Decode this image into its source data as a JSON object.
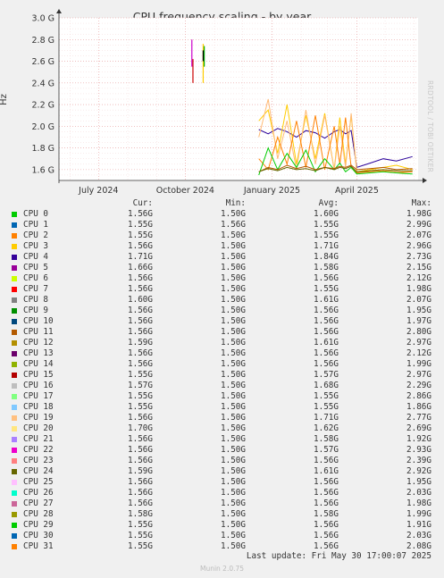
{
  "chart_data": {
    "type": "line",
    "title": "CPU frequency scaling - by year",
    "ylabel": "Hz",
    "ylim": [
      1.5,
      3.0
    ],
    "yticks": [
      "1.6 G",
      "1.8 G",
      "2.0 G",
      "2.2 G",
      "2.4 G",
      "2.6 G",
      "2.8 G",
      "3.0 G"
    ],
    "ytick_values": [
      1.6,
      1.8,
      2.0,
      2.2,
      2.4,
      2.6,
      2.8,
      3.0
    ],
    "xlim": [
      "2024-05-20",
      "2025-06-05"
    ],
    "xticks": [
      "July 2024",
      "October 2024",
      "January 2025",
      "April 2025"
    ],
    "xtick_dates": [
      "2024-07-01",
      "2024-10-01",
      "2025-01-01",
      "2025-04-01"
    ],
    "grid": true,
    "series": [
      {
        "name": "CPU 4",
        "color": "#2a0099",
        "y": [
          1.97,
          1.93,
          1.98,
          1.95,
          1.9,
          1.96,
          1.94,
          1.89,
          1.95,
          1.97,
          1.93,
          1.96,
          1.62,
          1.66,
          1.7,
          1.68,
          1.72
        ]
      },
      {
        "name": "CPU 3",
        "color": "#ffcc00",
        "y": [
          2.05,
          2.15,
          1.75,
          2.2,
          1.65,
          2.1,
          1.7,
          2.12,
          1.6,
          2.08,
          1.65,
          2.1,
          1.58,
          1.6,
          1.62,
          1.64,
          1.6
        ]
      },
      {
        "name": "CPU 19",
        "color": "#ffbb77",
        "y": [
          1.9,
          2.25,
          1.7,
          2.05,
          1.6,
          2.15,
          1.65,
          2.1,
          1.6,
          2.0,
          1.62,
          2.12,
          1.57,
          1.59,
          1.6,
          1.58,
          1.58
        ]
      },
      {
        "name": "CPU 2",
        "color": "#ff8000",
        "y": [
          1.7,
          1.6,
          1.9,
          1.65,
          2.05,
          1.62,
          2.1,
          1.6,
          2.0,
          1.65,
          2.08,
          1.62,
          1.57,
          1.58,
          1.59,
          1.57,
          1.58
        ]
      },
      {
        "name": "CPU 0",
        "color": "#00cc00",
        "y": [
          1.55,
          1.8,
          1.6,
          1.75,
          1.62,
          1.78,
          1.58,
          1.7,
          1.6,
          1.66,
          1.58,
          1.62,
          1.56,
          1.57,
          1.58,
          1.57,
          1.56
        ]
      },
      {
        "name": "CPU 11",
        "color": "#b35900",
        "y": [
          1.58,
          1.62,
          1.6,
          1.64,
          1.61,
          1.63,
          1.6,
          1.62,
          1.61,
          1.63,
          1.62,
          1.64,
          1.6,
          1.61,
          1.62,
          1.6,
          1.61
        ]
      },
      {
        "name": "CPU 24",
        "color": "#666600",
        "y": [
          1.58,
          1.61,
          1.59,
          1.62,
          1.6,
          1.61,
          1.59,
          1.62,
          1.6,
          1.62,
          1.61,
          1.63,
          1.58,
          1.59,
          1.6,
          1.59,
          1.59
        ]
      }
    ],
    "x_dates": [
      "2024-12-18",
      "2024-12-28",
      "2025-01-07",
      "2025-01-17",
      "2025-01-27",
      "2025-02-06",
      "2025-02-16",
      "2025-02-26",
      "2025-03-08",
      "2025-03-14",
      "2025-03-20",
      "2025-03-26",
      "2025-04-01",
      "2025-04-15",
      "2025-04-29",
      "2025-05-13",
      "2025-05-30"
    ],
    "spikes": [
      {
        "date": "2024-10-08",
        "y": [
          2.55,
          2.8
        ],
        "color": "#cc00cc"
      },
      {
        "date": "2024-10-08",
        "y": [
          2.4,
          2.62
        ],
        "color": "#cc0000"
      },
      {
        "date": "2024-10-20",
        "y": [
          2.4,
          2.76
        ],
        "color": "#ffcc00"
      },
      {
        "date": "2024-10-20",
        "y": [
          2.55,
          2.74
        ],
        "color": "#00aa00"
      },
      {
        "date": "2024-10-20",
        "y": [
          2.6,
          2.7
        ],
        "color": "#000000"
      }
    ]
  },
  "legend": {
    "headers": {
      "cur": "Cur:",
      "min": "Min:",
      "avg": "Avg:",
      "max": "Max:"
    },
    "rows": [
      {
        "name": "CPU 0",
        "color": "#00cc00",
        "cur": "1.56G",
        "min": "1.50G",
        "avg": "1.60G",
        "max": "1.98G"
      },
      {
        "name": "CPU 1",
        "color": "#0066b3",
        "cur": "1.55G",
        "min": "1.56G",
        "avg": "1.55G",
        "max": "2.99G"
      },
      {
        "name": "CPU 2",
        "color": "#ff8000",
        "cur": "1.55G",
        "min": "1.50G",
        "avg": "1.55G",
        "max": "2.07G"
      },
      {
        "name": "CPU 3",
        "color": "#ffcc00",
        "cur": "1.56G",
        "min": "1.50G",
        "avg": "1.71G",
        "max": "2.96G"
      },
      {
        "name": "CPU 4",
        "color": "#330099",
        "cur": "1.71G",
        "min": "1.50G",
        "avg": "1.84G",
        "max": "2.73G"
      },
      {
        "name": "CPU 5",
        "color": "#990099",
        "cur": "1.66G",
        "min": "1.50G",
        "avg": "1.58G",
        "max": "2.15G"
      },
      {
        "name": "CPU 6",
        "color": "#ccff00",
        "cur": "1.56G",
        "min": "1.50G",
        "avg": "1.56G",
        "max": "2.12G"
      },
      {
        "name": "CPU 7",
        "color": "#ff0000",
        "cur": "1.56G",
        "min": "1.50G",
        "avg": "1.55G",
        "max": "1.98G"
      },
      {
        "name": "CPU 8",
        "color": "#808080",
        "cur": "1.60G",
        "min": "1.50G",
        "avg": "1.61G",
        "max": "2.07G"
      },
      {
        "name": "CPU 9",
        "color": "#008f00",
        "cur": "1.56G",
        "min": "1.50G",
        "avg": "1.56G",
        "max": "1.95G"
      },
      {
        "name": "CPU 10",
        "color": "#00487d",
        "cur": "1.56G",
        "min": "1.50G",
        "avg": "1.56G",
        "max": "1.97G"
      },
      {
        "name": "CPU 11",
        "color": "#b35a00",
        "cur": "1.56G",
        "min": "1.50G",
        "avg": "1.56G",
        "max": "2.80G"
      },
      {
        "name": "CPU 12",
        "color": "#b38f00",
        "cur": "1.59G",
        "min": "1.50G",
        "avg": "1.61G",
        "max": "2.97G"
      },
      {
        "name": "CPU 13",
        "color": "#6b006b",
        "cur": "1.56G",
        "min": "1.50G",
        "avg": "1.56G",
        "max": "2.12G"
      },
      {
        "name": "CPU 14",
        "color": "#8fb300",
        "cur": "1.56G",
        "min": "1.50G",
        "avg": "1.56G",
        "max": "1.99G"
      },
      {
        "name": "CPU 15",
        "color": "#b30000",
        "cur": "1.55G",
        "min": "1.50G",
        "avg": "1.57G",
        "max": "2.97G"
      },
      {
        "name": "CPU 16",
        "color": "#bebebe",
        "cur": "1.57G",
        "min": "1.50G",
        "avg": "1.68G",
        "max": "2.29G"
      },
      {
        "name": "CPU 17",
        "color": "#80ff80",
        "cur": "1.55G",
        "min": "1.50G",
        "avg": "1.55G",
        "max": "2.86G"
      },
      {
        "name": "CPU 18",
        "color": "#80c9ff",
        "cur": "1.55G",
        "min": "1.50G",
        "avg": "1.55G",
        "max": "1.86G"
      },
      {
        "name": "CPU 19",
        "color": "#ffc080",
        "cur": "1.56G",
        "min": "1.50G",
        "avg": "1.71G",
        "max": "2.77G"
      },
      {
        "name": "CPU 20",
        "color": "#ffe680",
        "cur": "1.70G",
        "min": "1.50G",
        "avg": "1.62G",
        "max": "2.69G"
      },
      {
        "name": "CPU 21",
        "color": "#aa80ff",
        "cur": "1.56G",
        "min": "1.50G",
        "avg": "1.58G",
        "max": "1.92G"
      },
      {
        "name": "CPU 22",
        "color": "#ee00cc",
        "cur": "1.56G",
        "min": "1.50G",
        "avg": "1.57G",
        "max": "2.93G"
      },
      {
        "name": "CPU 23",
        "color": "#ff8080",
        "cur": "1.56G",
        "min": "1.50G",
        "avg": "1.56G",
        "max": "2.39G"
      },
      {
        "name": "CPU 24",
        "color": "#666600",
        "cur": "1.59G",
        "min": "1.50G",
        "avg": "1.61G",
        "max": "2.92G"
      },
      {
        "name": "CPU 25",
        "color": "#ffbfff",
        "cur": "1.56G",
        "min": "1.50G",
        "avg": "1.56G",
        "max": "1.95G"
      },
      {
        "name": "CPU 26",
        "color": "#00ffcc",
        "cur": "1.56G",
        "min": "1.50G",
        "avg": "1.56G",
        "max": "2.03G"
      },
      {
        "name": "CPU 27",
        "color": "#cc6699",
        "cur": "1.56G",
        "min": "1.50G",
        "avg": "1.56G",
        "max": "1.98G"
      },
      {
        "name": "CPU 28",
        "color": "#999900",
        "cur": "1.58G",
        "min": "1.50G",
        "avg": "1.58G",
        "max": "1.99G"
      },
      {
        "name": "CPU 29",
        "color": "#00cc00",
        "cur": "1.55G",
        "min": "1.50G",
        "avg": "1.56G",
        "max": "1.91G"
      },
      {
        "name": "CPU 30",
        "color": "#0066b3",
        "cur": "1.55G",
        "min": "1.50G",
        "avg": "1.56G",
        "max": "2.03G"
      },
      {
        "name": "CPU 31",
        "color": "#ff8000",
        "cur": "1.55G",
        "min": "1.50G",
        "avg": "1.56G",
        "max": "2.08G"
      }
    ]
  },
  "footer": {
    "last_update": "Last update: Fri May 30 17:00:07 2025",
    "version": "Munin 2.0.75"
  },
  "watermark": "RRDTOOL / TOBI OETIKER"
}
